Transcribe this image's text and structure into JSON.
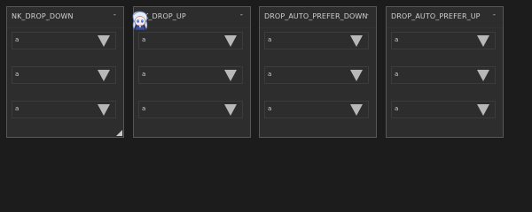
{
  "windows": [
    {
      "title": "NK_DROP_DOWN",
      "minimize_symbol": "-",
      "combos": [
        "a",
        "a",
        "a"
      ]
    },
    {
      "title": "NK_DROP_UP",
      "minimize_symbol": "-",
      "combos": [
        "a",
        "a",
        "a"
      ]
    },
    {
      "title": "DROP_AUTO_PREFER_DOWN",
      "minimize_symbol": "-",
      "combos": [
        "a",
        "a",
        "a"
      ]
    },
    {
      "title": "DROP_AUTO_PREFER_UP",
      "minimize_symbol": "-",
      "combos": [
        "a",
        "a",
        "a"
      ]
    }
  ],
  "icons": {
    "combo_arrow": "triangle-down-icon",
    "resize": "resize-grip-icon",
    "cursor": "anime-character-cursor-icon"
  },
  "colors": {
    "background": "#1c1c1d",
    "window_bg": "#2d2d2e",
    "window_border": "#575758",
    "text": "#d0d0d0",
    "arrow": "#b8b8b8"
  }
}
